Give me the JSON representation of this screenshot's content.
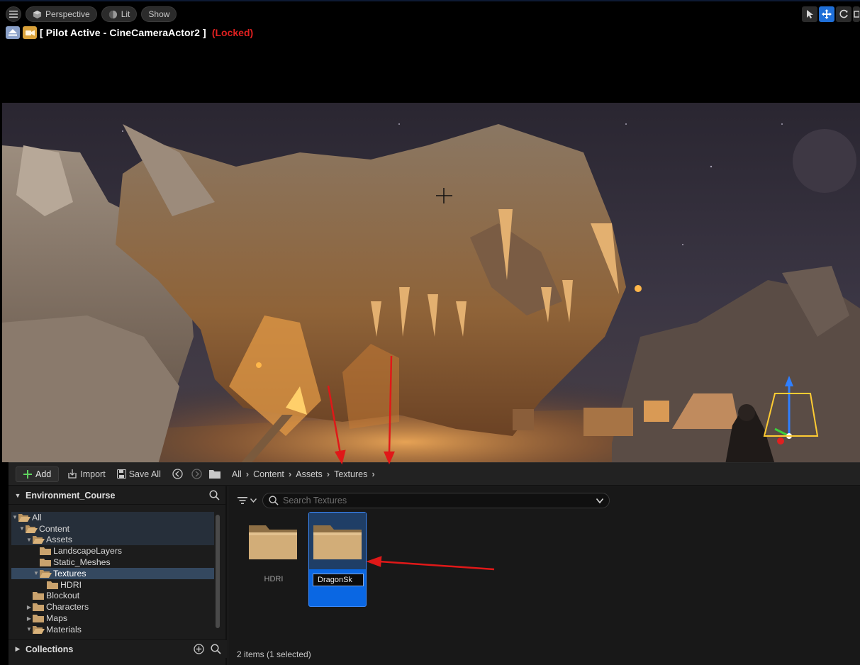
{
  "viewport": {
    "toolbar": {
      "perspective_label": "Perspective",
      "lit_label": "Lit",
      "show_label": "Show"
    },
    "pilot": {
      "text": "[ Pilot Active - CineCameraActor2 ]",
      "locked": "(Locked)"
    },
    "accent_color": "#1f6fd8"
  },
  "content_browser": {
    "toolbar": {
      "add_label": "Add",
      "import_label": "Import",
      "save_all_label": "Save All"
    },
    "breadcrumb": [
      "All",
      "Content",
      "Assets",
      "Textures"
    ],
    "tree": {
      "title": "Environment_Course",
      "items": [
        {
          "label": "All",
          "depth": 0,
          "expanded": true,
          "state": "band"
        },
        {
          "label": "Content",
          "depth": 1,
          "expanded": true,
          "state": "band"
        },
        {
          "label": "Assets",
          "depth": 2,
          "expanded": true,
          "state": "band"
        },
        {
          "label": "LandscapeLayers",
          "depth": 3,
          "expanded": null,
          "state": ""
        },
        {
          "label": "Static_Meshes",
          "depth": 3,
          "expanded": null,
          "state": ""
        },
        {
          "label": "Textures",
          "depth": 3,
          "expanded": true,
          "state": "sel"
        },
        {
          "label": "HDRI",
          "depth": 4,
          "expanded": null,
          "state": ""
        },
        {
          "label": "Blockout",
          "depth": 2,
          "expanded": null,
          "state": ""
        },
        {
          "label": "Characters",
          "depth": 2,
          "expanded": false,
          "state": ""
        },
        {
          "label": "Maps",
          "depth": 2,
          "expanded": false,
          "state": ""
        },
        {
          "label": "Materials",
          "depth": 2,
          "expanded": true,
          "state": ""
        }
      ]
    },
    "collections_label": "Collections",
    "search": {
      "placeholder": "Search Textures",
      "value": ""
    },
    "assets": [
      {
        "label": "HDRI",
        "selected": false
      },
      {
        "label": "",
        "rename_value": "DragonSk",
        "selected": true
      }
    ],
    "status_text": "2 items (1 selected)"
  }
}
